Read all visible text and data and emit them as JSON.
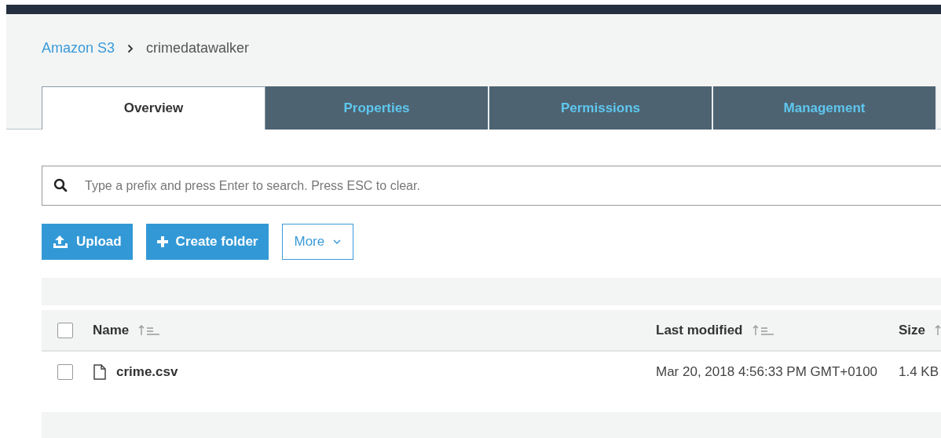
{
  "breadcrumb": [
    {
      "label": "Amazon S3",
      "kind": "link"
    },
    {
      "label": "crimedatawalker",
      "kind": "current"
    }
  ],
  "tabs": [
    {
      "label": "Overview",
      "selected": true
    },
    {
      "label": "Properties",
      "selected": false
    },
    {
      "label": "Permissions",
      "selected": false
    },
    {
      "label": "Management",
      "selected": false
    }
  ],
  "search": {
    "placeholder": "Type a prefix and press Enter to search. Press ESC to clear."
  },
  "buttons": [
    {
      "label": "Upload",
      "kind": "upload"
    },
    {
      "label": "Create folder",
      "kind": "create"
    },
    {
      "label": "More",
      "kind": "menu"
    }
  ],
  "table": {
    "select_all": {
      "checked": false
    },
    "columns": [
      {
        "label": "Name"
      },
      {
        "label": "Last modified"
      },
      {
        "label": "Size"
      }
    ],
    "rows": [
      {
        "checked": false,
        "name": "crime.csv",
        "modified": "Mar 20, 2018 4:56:33 PM GMT+0100",
        "size": "1.4 KB"
      }
    ]
  }
}
